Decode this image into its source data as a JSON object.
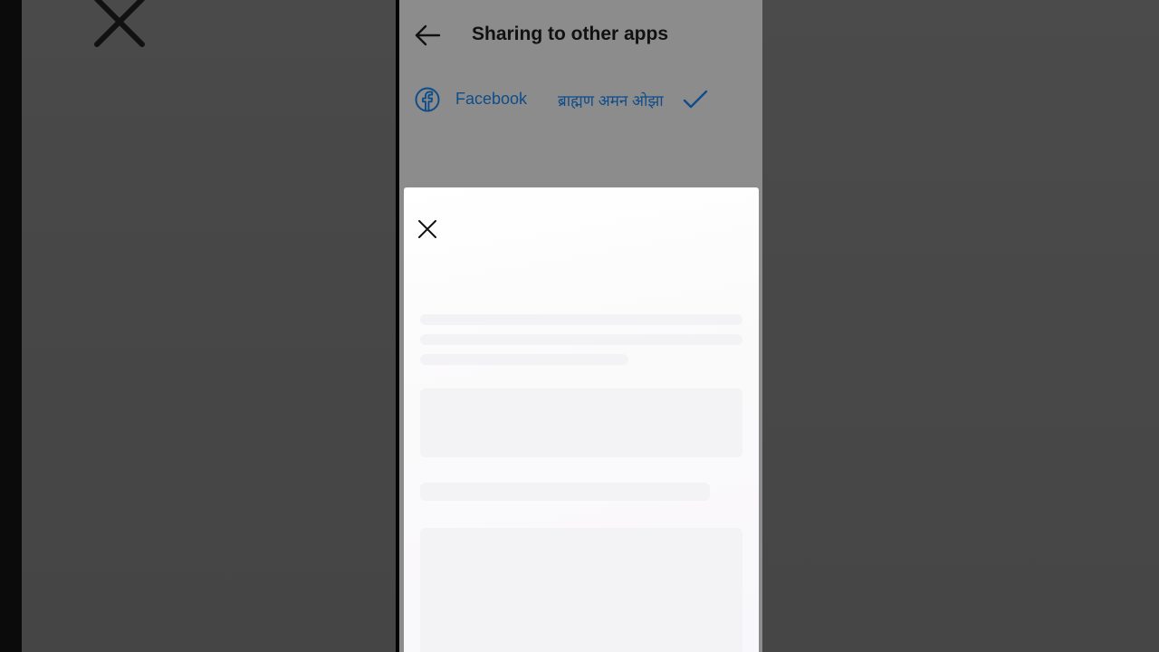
{
  "header": {
    "title": "Sharing to other apps",
    "back_icon": "arrow-left-icon"
  },
  "share_targets": [
    {
      "app": "Facebook",
      "icon": "facebook-icon",
      "account": "ब्राह्मण अमन ओझा",
      "status_icon": "checkmark-icon",
      "selected": true
    }
  ],
  "sheet": {
    "close_icon": "close-icon"
  },
  "colors": {
    "accent": "#0f4c8a",
    "overlay": "#8c8c8c",
    "sheet": "#fbfafb"
  }
}
